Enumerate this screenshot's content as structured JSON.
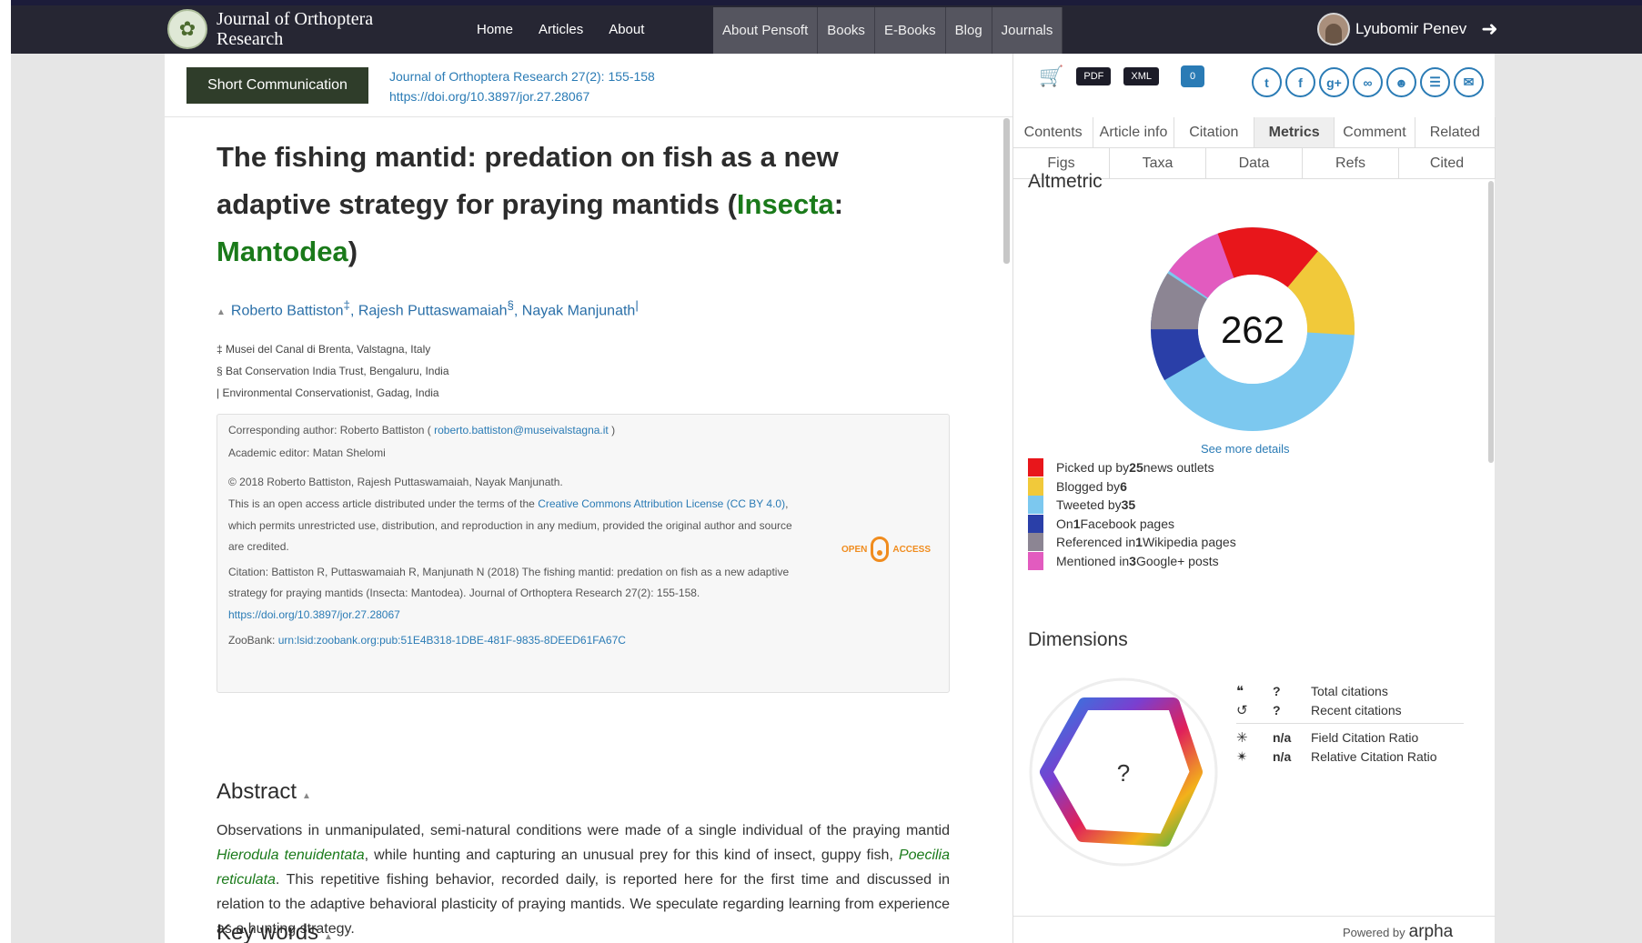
{
  "nav": {
    "journal_title": "Journal of Orthoptera Research",
    "links": [
      "Home",
      "Articles",
      "About"
    ],
    "group": [
      "About Pensoft",
      "Books",
      "E-Books",
      "Blog",
      "Journals"
    ],
    "user_name": "Lyubomir Penev"
  },
  "article": {
    "type": "Short Communication",
    "citation_line": "Journal of Orthoptera Research 27(2): 155-158",
    "doi": "https://doi.org/10.3897/jor.27.28067",
    "title_main": "The fishing mantid: predation on fish as a new adaptive strategy for praying mantids (",
    "title_taxon1": "Insecta",
    "title_colon": ": ",
    "title_taxon2": "Mantodea",
    "title_close": ")",
    "authors": [
      {
        "name": "Roberto Battiston",
        "mark": "‡"
      },
      {
        "name": "Rajesh Puttaswamaiah",
        "mark": "§"
      },
      {
        "name": "Nayak Manjunath",
        "mark": "|"
      }
    ],
    "affiliations": [
      "‡ Musei del Canal di Brenta, Valstagna, Italy",
      "§ Bat Conservation India Trust, Bengaluru, India",
      "| Environmental Conservationist, Gadag, India"
    ]
  },
  "info": {
    "corr_label": "Corresponding author: Roberto Battiston (",
    "corr_email": "roberto.battiston@museivalstagna.it",
    "corr_end": ")",
    "editor": "Academic editor: Matan Shelomi",
    "copyright": "© 2018 Roberto Battiston, Rajesh Puttaswamaiah, Nayak Manjunath.",
    "license_pre": "This is an open access article distributed under the terms of the",
    "license_link": "Creative Commons Attribution License (CC BY 4.0)",
    "license_post": ",",
    "license_line2": "which permits unrestricted use, distribution, and reproduction in any medium, provided the original author and source",
    "license_line3": "are credited.",
    "citation1": "Citation: Battiston R, Puttaswamaiah R, Manjunath N (2018) The fishing mantid: predation on fish as a new adaptive",
    "citation2": "strategy for praying mantids (Insecta: Mantodea). Journal of Orthoptera Research 27(2): 155-158.",
    "citation_doi": "https://doi.org/10.3897/jor.27.28067",
    "zoobank_label": "ZooBank:",
    "zoobank_link": "urn:lsid:zoobank.org:pub:51E4B318-1DBE-481F-9835-8DEED61FA67C",
    "oa_left": "OPEN",
    "oa_right": "ACCESS"
  },
  "abstract": {
    "heading": "Abstract",
    "p1": "Observations in unmanipulated, semi-natural conditions were made of a single individual of the praying mantid ",
    "sp1": "Hierodula tenuidentata",
    "p2": ", while hunting and capturing an unusual prey for this kind of insect, guppy fish, ",
    "sp2": "Poecilia reticulata",
    "p3": ". This repetitive fishing behavior, recorded daily, is reported here for the first time and discussed in relation to the adaptive behavioral plasticity of praying mantids. We speculate regarding learning from experience as a hunting strategy."
  },
  "keywords_heading": "Key words",
  "side": {
    "tools": {
      "pdf": "PDF",
      "xml": "XML",
      "comments": "0"
    },
    "tabs_row1": [
      "Contents",
      "Article info",
      "Citation",
      "Metrics",
      "Comment",
      "Related"
    ],
    "tabs_row2": [
      "Figs",
      "Taxa",
      "Data",
      "Refs",
      "Cited"
    ],
    "active_tab": "Metrics",
    "altmetric": {
      "heading": "Altmetric",
      "score": "262",
      "see_more": "See more details",
      "items": [
        {
          "pre": "Picked up by ",
          "n": "25",
          "post": " news outlets",
          "color": "#e8161b"
        },
        {
          "pre": "Blogged by ",
          "n": "6",
          "post": "",
          "color": "#f1c93a"
        },
        {
          "pre": "Tweeted by ",
          "n": "35",
          "post": "",
          "color": "#7cc8ef"
        },
        {
          "pre": "On ",
          "n": "1",
          "post": " Facebook pages",
          "color": "#2a3fa8"
        },
        {
          "pre": "Referenced in ",
          "n": "1",
          "post": " Wikipedia pages",
          "color": "#8c8593"
        },
        {
          "pre": "Mentioned in ",
          "n": "3",
          "post": " Google+ posts",
          "color": "#e25bbf"
        }
      ]
    },
    "dimensions": {
      "heading": "Dimensions",
      "center": "?",
      "rows": [
        {
          "value": "?",
          "label": "Total citations"
        },
        {
          "value": "?",
          "label": "Recent citations"
        },
        {
          "value": "n/a",
          "label": "Field Citation Ratio"
        },
        {
          "value": "n/a",
          "label": "Relative Citation Ratio"
        }
      ]
    },
    "powered_by": "Powered by",
    "powered_brand": "arpha"
  }
}
